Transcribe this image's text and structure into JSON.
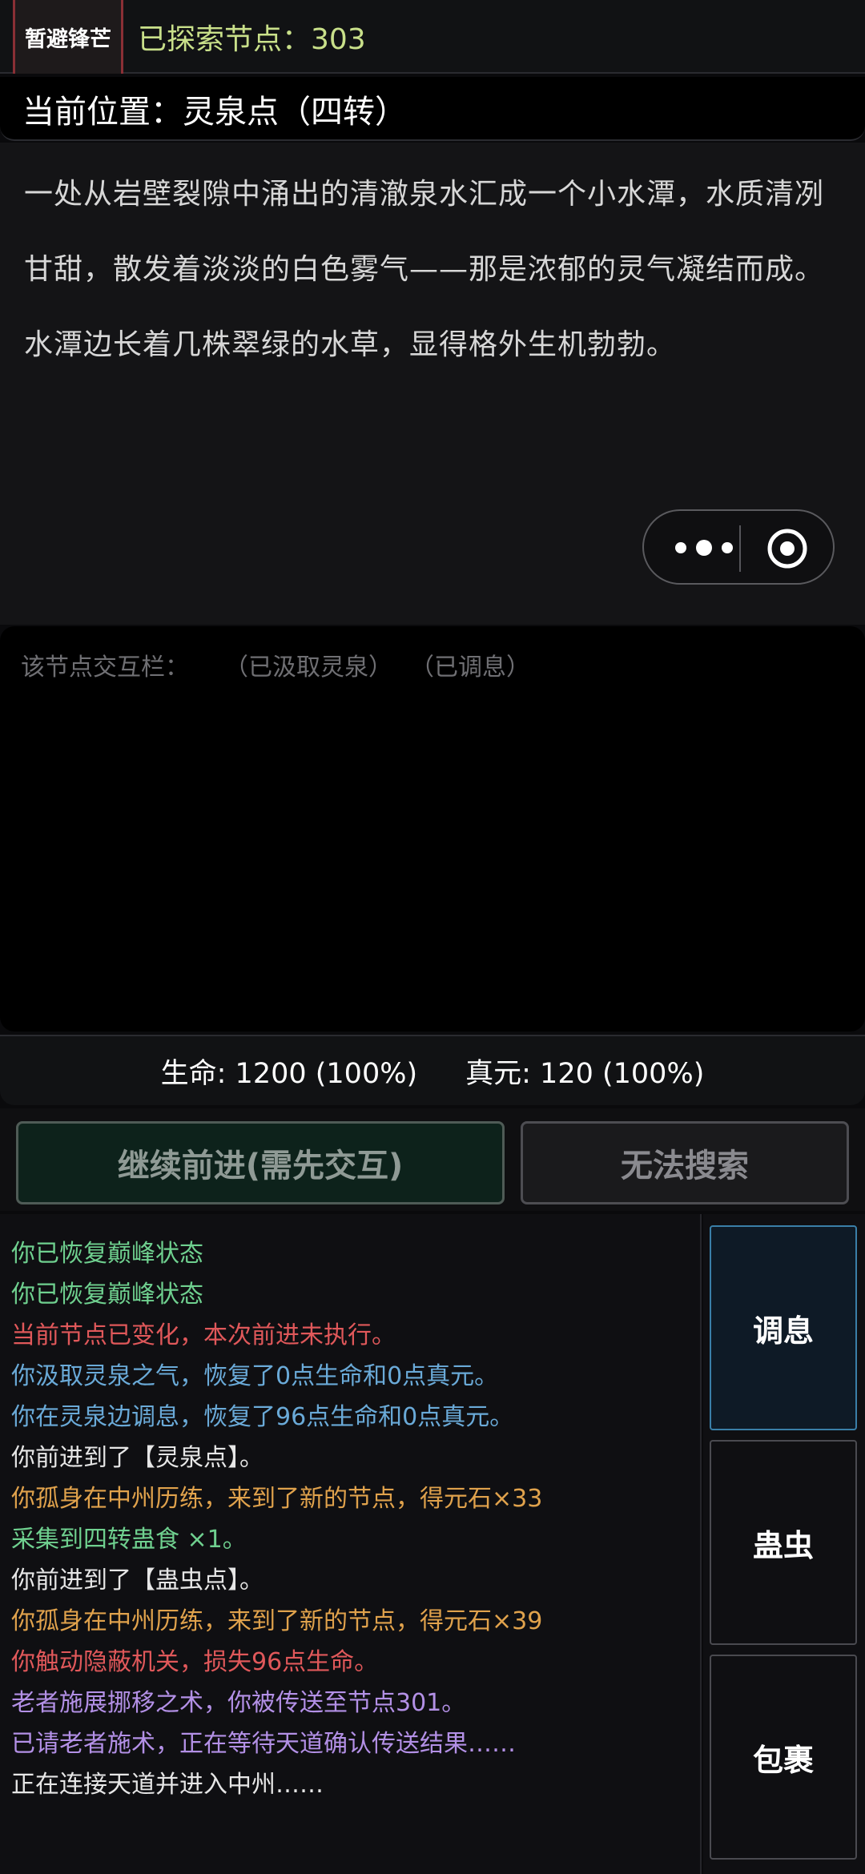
{
  "top_bar": {
    "flee_label": "暂避锋芒",
    "explored_text": "已探索节点：303"
  },
  "location": {
    "text": "当前位置：灵泉点（四转）"
  },
  "description": {
    "text": "一处从岩壁裂隙中涌出的清澈泉水汇成一个小水潭，水质清冽甘甜，散发着淡淡的白色雾气——那是浓郁的灵气凝结而成。水潭边长着几株翠绿的水草，显得格外生机勃勃。"
  },
  "capsule": {
    "more_icon": "more-dots-icon",
    "close_icon": "target-circle-icon"
  },
  "interaction": {
    "label": "该节点交互栏：",
    "tags": [
      "（已汲取灵泉）",
      "（已调息）"
    ]
  },
  "stats": {
    "hp": "生命: 1200 (100%)",
    "mp": "真元: 120 (100%)"
  },
  "actions": {
    "forward_label": "继续前进(需先交互)",
    "search_label": "无法搜索"
  },
  "log": [
    {
      "text": "你已恢复巅峰状态",
      "color": "#6fd08f"
    },
    {
      "text": "你已恢复巅峰状态",
      "color": "#6fd08f"
    },
    {
      "text": "当前节点已变化，本次前进未执行。",
      "color": "#e0585a"
    },
    {
      "text": "你汲取灵泉之气，恢复了0点生命和0点真元。",
      "color": "#6aaad8"
    },
    {
      "text": "你在灵泉边调息，恢复了96点生命和0点真元。",
      "color": "#6aaad8"
    },
    {
      "text": "你前进到了【灵泉点】。",
      "color": "#e6e6e6"
    },
    {
      "text": "你孤身在中州历练，来到了新的节点，得元石×33",
      "color": "#e0a24c"
    },
    {
      "text": "采集到四转蛊食 ×1。",
      "color": "#6fd08f"
    },
    {
      "text": "你前进到了【蛊虫点】。",
      "color": "#e6e6e6"
    },
    {
      "text": "你孤身在中州历练，来到了新的节点，得元石×39",
      "color": "#e0a24c"
    },
    {
      "text": "你触动隐蔽机关，损失96点生命。",
      "color": "#e0585a"
    },
    {
      "text": "老者施展挪移之术，你被传送至节点301。",
      "color": "#b390e6"
    },
    {
      "text": "已请老者施术，正在等待天道确认传送结果……",
      "color": "#b390e6"
    },
    {
      "text": "正在连接天道并进入中州……",
      "color": "#e6e6e6"
    }
  ],
  "side_buttons": [
    {
      "label": "调息",
      "active": true
    },
    {
      "label": "蛊虫",
      "active": false
    },
    {
      "label": "包裹",
      "active": false
    }
  ]
}
